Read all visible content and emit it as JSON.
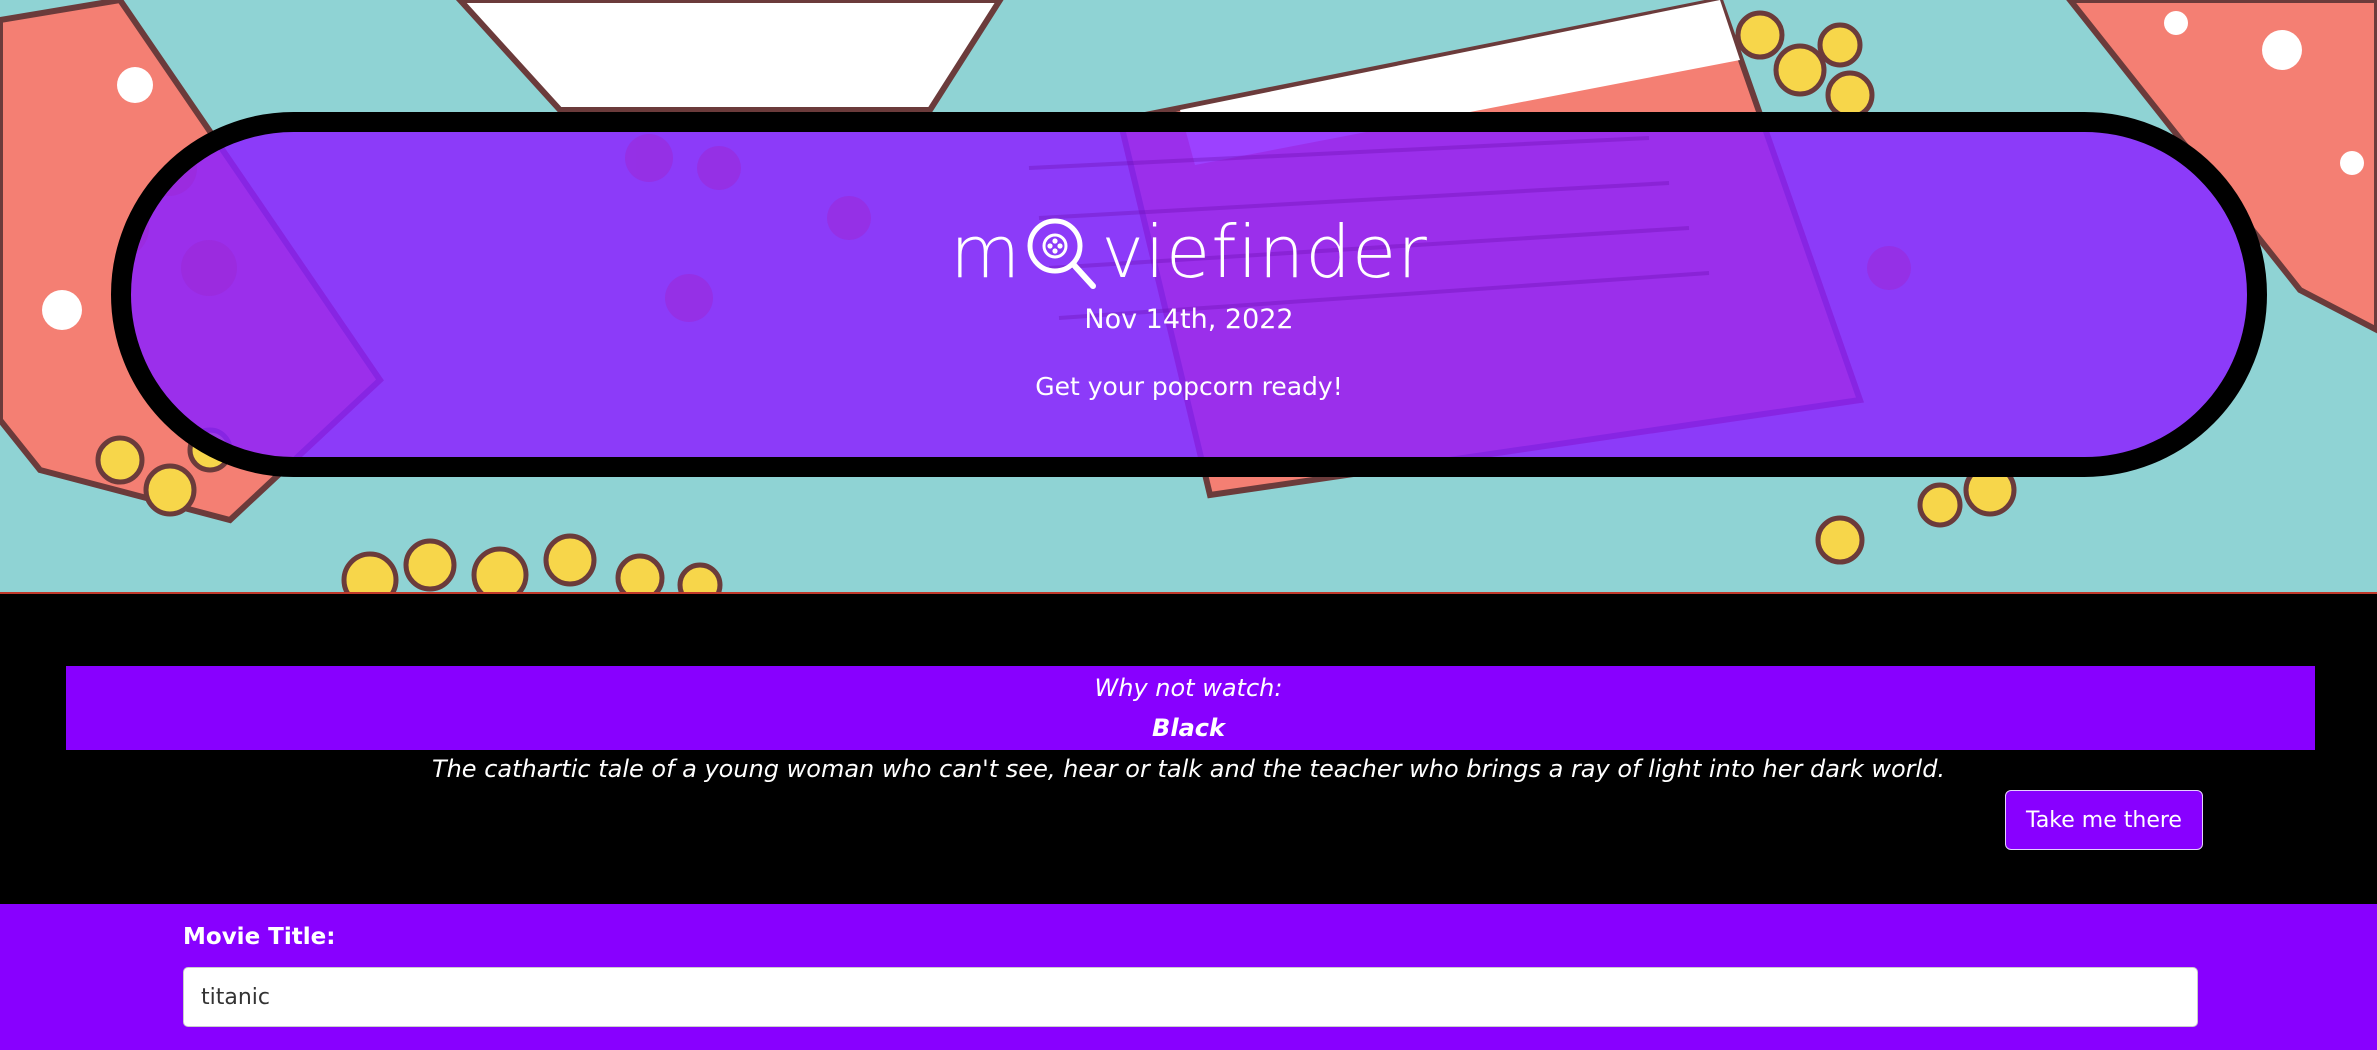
{
  "header": {
    "logo_text_left": "m",
    "logo_text_right": "viefinder",
    "date": "Nov 14th, 2022",
    "tagline": "Get your popcorn ready!"
  },
  "suggestion": {
    "lead": "Why not watch:",
    "title": "Black",
    "description": "The cathartic tale of a young woman who can't see, hear or talk and the teacher who brings a ray of light into her dark world.",
    "button_label": "Take me there"
  },
  "search": {
    "label": "Movie Title:",
    "value": "titanic"
  },
  "colors": {
    "hero_bg": "#8fd3d4",
    "pill_purple": "#8c22ff",
    "accent_purple": "#8800ff",
    "popcorn_box_red": "#f47f73",
    "popcorn_yellow": "#f7d64a"
  },
  "icons": {
    "logo_o": "magnifier-film-reel-icon"
  }
}
